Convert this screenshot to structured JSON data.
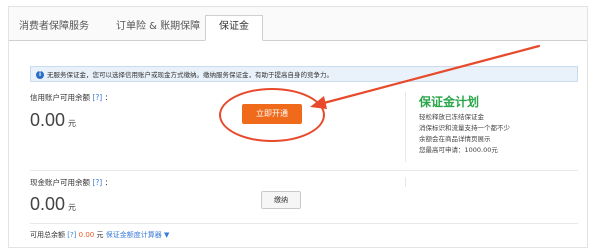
{
  "tabs": [
    {
      "label": "消费者保障服务"
    },
    {
      "label": "订单险 & 账期保障"
    },
    {
      "label": "保证金"
    }
  ],
  "info": {
    "icon": "info-icon",
    "text": "无服务保证金，您可以选择信用账户或现金方式缴纳。缴纳服务保证金，有助于提高自身的竞争力。"
  },
  "credit": {
    "label": "信用账户可用余额",
    "help": "[?]",
    "colon": "：",
    "amount": "0.00",
    "unit": "元",
    "button": "立即开通"
  },
  "plan": {
    "logo": "保证金计划",
    "lines": [
      "轻松释放已冻结保证金",
      "消保标识和流量支持一个都不少",
      "余额会在商品详情页展示",
      "您最高可申请：1000.00元"
    ]
  },
  "cash": {
    "label": "现金账户可用余额",
    "help": "[?]",
    "colon": "：",
    "amount": "0.00",
    "unit": "元",
    "button": "缴纳"
  },
  "total": {
    "label": "可用总余额",
    "help": "[?]",
    "amount": "0.00",
    "unit": "元",
    "calculator": "保证金额度计算器"
  },
  "colors": {
    "accent": "#f06a1b",
    "annotation": "#e84a2c",
    "plan_green": "#2aa54a",
    "link_blue": "#3b7bd8"
  }
}
